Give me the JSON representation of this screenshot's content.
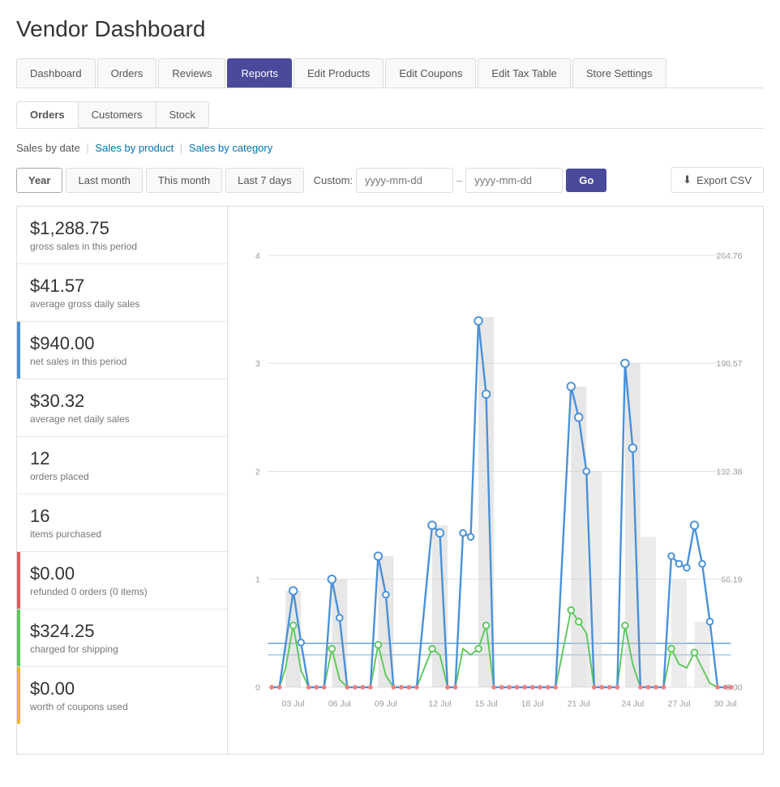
{
  "page": {
    "title": "Vendor Dashboard"
  },
  "nav": {
    "tabs": [
      {
        "id": "dashboard",
        "label": "Dashboard",
        "active": false
      },
      {
        "id": "orders",
        "label": "Orders",
        "active": false
      },
      {
        "id": "reviews",
        "label": "Reviews",
        "active": false
      },
      {
        "id": "reports",
        "label": "Reports",
        "active": true
      },
      {
        "id": "edit-products",
        "label": "Edit Products",
        "active": false
      },
      {
        "id": "edit-coupons",
        "label": "Edit Coupons",
        "active": false
      },
      {
        "id": "edit-tax-table",
        "label": "Edit Tax Table",
        "active": false
      },
      {
        "id": "store-settings",
        "label": "Store Settings",
        "active": false
      }
    ]
  },
  "sub_tabs": [
    {
      "id": "orders-tab",
      "label": "Orders",
      "active": true
    },
    {
      "id": "customers-tab",
      "label": "Customers",
      "active": false
    },
    {
      "id": "stock-tab",
      "label": "Stock",
      "active": false
    }
  ],
  "report_links": {
    "sales_by_date": "Sales by date",
    "sales_by_product": "Sales by product",
    "sales_by_category": "Sales by category"
  },
  "filter": {
    "buttons": [
      {
        "id": "year",
        "label": "Year",
        "active": true
      },
      {
        "id": "last-month",
        "label": "Last month",
        "active": false
      },
      {
        "id": "this-month",
        "label": "This month",
        "active": false
      },
      {
        "id": "last-7-days",
        "label": "Last 7 days",
        "active": false
      }
    ],
    "custom_label": "Custom:",
    "date_placeholder_start": "yyyy-mm-dd",
    "date_placeholder_end": "yyyy-mm-dd",
    "go_label": "Go",
    "export_label": "Export CSV"
  },
  "stats": [
    {
      "id": "gross-sales",
      "value": "$1,288.75",
      "label": "gross sales in this period",
      "bar_color": null
    },
    {
      "id": "avg-daily-gross",
      "value": "$41.57",
      "label": "average gross daily sales",
      "bar_color": null
    },
    {
      "id": "net-sales",
      "value": "$940.00",
      "label": "net sales in this period",
      "bar_color": "#4a90d9"
    },
    {
      "id": "avg-net-daily",
      "value": "$30.32",
      "label": "average net daily sales",
      "bar_color": null
    },
    {
      "id": "orders-placed",
      "value": "12",
      "label": "orders placed",
      "bar_color": null
    },
    {
      "id": "items-purchased",
      "value": "16",
      "label": "items purchased",
      "bar_color": null
    },
    {
      "id": "refunded",
      "value": "$0.00",
      "label": "refunded 0 orders (0 items)",
      "bar_color": "#e05c5c"
    },
    {
      "id": "charged-shipping",
      "value": "$324.25",
      "label": "charged for shipping",
      "bar_color": "#5bc85b"
    },
    {
      "id": "coupons-used",
      "value": "$0.00",
      "label": "worth of coupons used",
      "bar_color": "#f0b429"
    }
  ],
  "chart": {
    "y_labels": [
      "0",
      "1",
      "2",
      "3",
      "4"
    ],
    "y_values": [
      "0.00",
      "66.19",
      "132.38",
      "198.57",
      "264.76"
    ],
    "x_labels": [
      "03 Jul",
      "06 Jul",
      "09 Jul",
      "12 Jul",
      "15 Jul",
      "18 Jul",
      "21 Jul",
      "24 Jul",
      "27 Jul",
      "30 Jul"
    ]
  }
}
